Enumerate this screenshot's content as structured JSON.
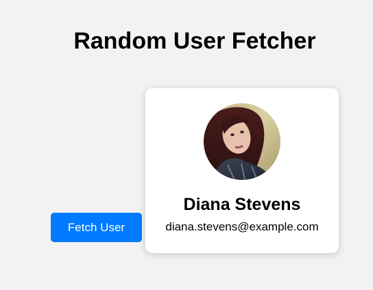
{
  "header": {
    "title": "Random User Fetcher"
  },
  "actions": {
    "fetch_label": "Fetch User",
    "accent_color": "#007bff"
  },
  "user_card": {
    "name": "Diana Stevens",
    "email": "diana.stevens@example.com",
    "avatar_icon": "user-photo"
  }
}
